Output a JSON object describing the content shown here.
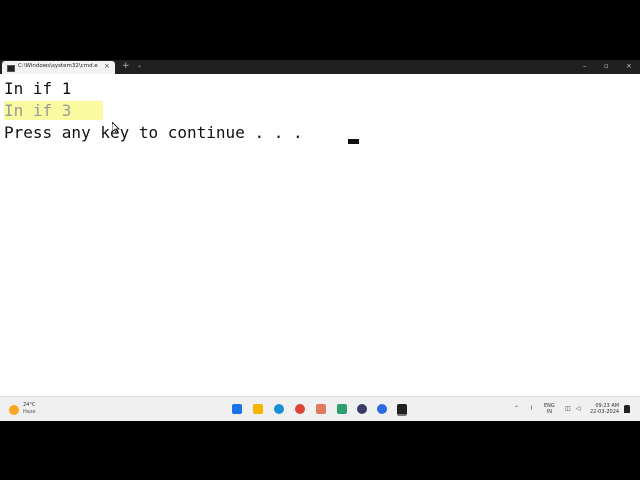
{
  "window": {
    "tab_title": "C:\\Windows\\system32\\cmd.e",
    "tab_close": "×",
    "new_tab": "+",
    "dropdown": "⌄",
    "minimize": "–",
    "maximize": "▫",
    "close": "×"
  },
  "terminal": {
    "lines": [
      "In if 1",
      "In if 3",
      "Press any key to continue . . . "
    ]
  },
  "taskbar": {
    "weather_temp": "24°C",
    "weather_cond": "Haze",
    "lang_line1": "ENG",
    "lang_line2": "IN",
    "time": "09:23 AM",
    "date": "22-03-2024"
  },
  "colors": {
    "highlight": "#fafaa0",
    "terminal_bg": "#ffffff",
    "titlebar_bg": "#202020"
  }
}
